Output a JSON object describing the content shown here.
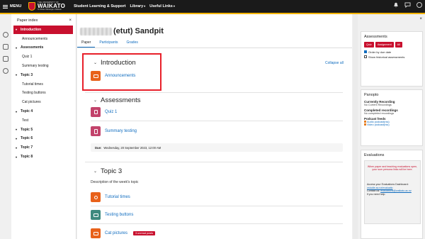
{
  "topbar": {
    "menu_label": "MENU",
    "logo_line1": "THE UNIVERSITY OF",
    "logo_name": "WAIKATO",
    "logo_line3": "Te Whare Wānanga o Waikato",
    "nav": [
      "Student Learning & Support",
      "Library",
      "Useful Links"
    ]
  },
  "paper_index": {
    "title": "Paper index",
    "close": "×",
    "items": [
      {
        "label": "Introduction",
        "type": "section",
        "active": true
      },
      {
        "label": "Announcements",
        "type": "item"
      },
      {
        "label": "Assessments",
        "type": "section"
      },
      {
        "label": "Quiz 1",
        "type": "item"
      },
      {
        "label": "Summary testing",
        "type": "item"
      },
      {
        "label": "Topic 3",
        "type": "section"
      },
      {
        "label": "Tutorial times",
        "type": "item"
      },
      {
        "label": "Testing buttons",
        "type": "item"
      },
      {
        "label": "Cat pictures",
        "type": "item"
      },
      {
        "label": "Topic 4",
        "type": "section"
      },
      {
        "label": "Test",
        "type": "item"
      },
      {
        "label": "Topic 5",
        "type": "section"
      },
      {
        "label": "Topic 6",
        "type": "section"
      },
      {
        "label": "Topic 7",
        "type": "section"
      },
      {
        "label": "Topic 8",
        "type": "section"
      }
    ]
  },
  "course": {
    "title_suffix": "(etut) Sandpit",
    "tabs": [
      "Paper",
      "Participants",
      "Grades"
    ],
    "collapse_all": "Collapse all",
    "sections": {
      "introduction": "Introduction",
      "assessments": "Assessments",
      "topic3": "Topic 3"
    },
    "activities": {
      "announcements": "Announcements",
      "quiz1": "Quiz 1",
      "summary": "Summary testing",
      "tutorial": "Tutorial times",
      "buttons": "Testing buttons",
      "cats": "Cat pictures"
    },
    "due_label": "Due:",
    "due_value": "Wednesday, 20 September 2023, 12:00 AM",
    "topic3_description": "Description of the week's topic",
    "unread_badge": "3 unread posts"
  },
  "right_panel": {
    "close": "×",
    "assessments": {
      "title": "Assessments",
      "buttons": [
        "Quiz",
        "Assignment",
        "All"
      ],
      "checkboxes": [
        {
          "label": "Order by due date",
          "checked": true
        },
        {
          "label": "Show historical assessments",
          "checked": false
        }
      ]
    },
    "panopto": {
      "title": "Panopto",
      "current_h": "Currently Recording",
      "current_t": "No Current Recordings",
      "completed_h": "Completed recordings",
      "completed_t": "No completed recordings",
      "podcast_h": "Podcast feeds",
      "feeds": [
        "Audio podcast(rss)",
        "Video podcast(rss)"
      ]
    },
    "evaluations": {
      "title": "Evaluations",
      "notice": "When paper and teaching evaluations open, your sum persona links will be here.",
      "access_text": "Access your Evaluations Dashboard:",
      "dashboard_link": "ostudie.ac.nz/evaluatio",
      "contact_text": "Contact us:",
      "contact_link": "evaluations@waikato.ac.nz",
      "contact_tail": "if you need help."
    }
  },
  "colors": {
    "brand_red": "#c8102e",
    "accent_gold": "#f4b400",
    "link_blue": "#0f6cbf",
    "forum_orange": "#e8611a",
    "quiz_pink": "#c2436b",
    "tutorial_orange": "#e8611a",
    "buttons_teal": "#3e8a7e"
  }
}
